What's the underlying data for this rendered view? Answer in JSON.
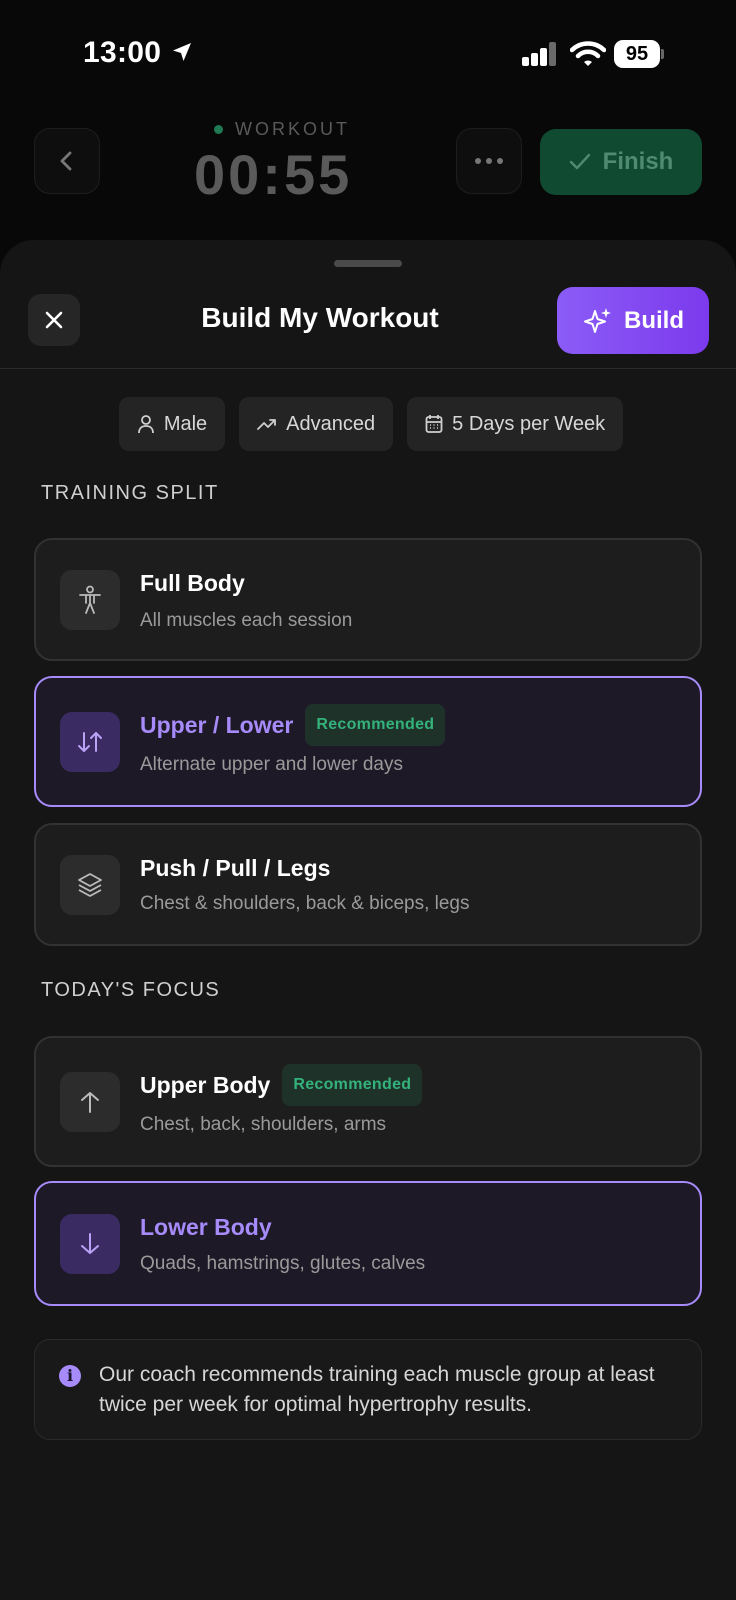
{
  "status_bar": {
    "time": "13:00",
    "battery": "95"
  },
  "workout_header": {
    "label": "WORKOUT",
    "timer": "00:55",
    "finish_label": "Finish"
  },
  "sheet": {
    "title": "Build My Workout",
    "build_label": "Build",
    "chips": [
      {
        "label": "Male",
        "icon": "person-icon"
      },
      {
        "label": "Advanced",
        "icon": "trend-up-icon"
      },
      {
        "label": "5 Days per Week",
        "icon": "calendar-icon"
      }
    ],
    "training_split": {
      "label": "TRAINING SPLIT",
      "options": [
        {
          "title": "Full Body",
          "subtitle": "All muscles each session",
          "icon": "body-icon",
          "selected": false
        },
        {
          "title": "Upper / Lower",
          "subtitle": "Alternate upper and lower days",
          "icon": "swap-vertical-icon",
          "selected": true,
          "badge": "Recommended"
        },
        {
          "title": "Push / Pull / Legs",
          "subtitle": "Chest & shoulders, back & biceps, legs",
          "icon": "layers-icon",
          "selected": false
        }
      ]
    },
    "todays_focus": {
      "label": "TODAY'S FOCUS",
      "options": [
        {
          "title": "Upper Body",
          "subtitle": "Chest, back, shoulders, arms",
          "icon": "arrow-up-icon",
          "selected": false,
          "badge": "Recommended"
        },
        {
          "title": "Lower Body",
          "subtitle": "Quads, hamstrings, glutes, calves",
          "icon": "arrow-down-icon",
          "selected": true
        }
      ]
    },
    "info_text": "Our coach recommends training each muscle group at least twice per week for optimal hypertrophy results."
  },
  "colors": {
    "accent_purple": "#a78bfa",
    "build_purple": "#8b5cf6",
    "finish_green": "#0f4a31",
    "badge_green": "#34b27b"
  }
}
